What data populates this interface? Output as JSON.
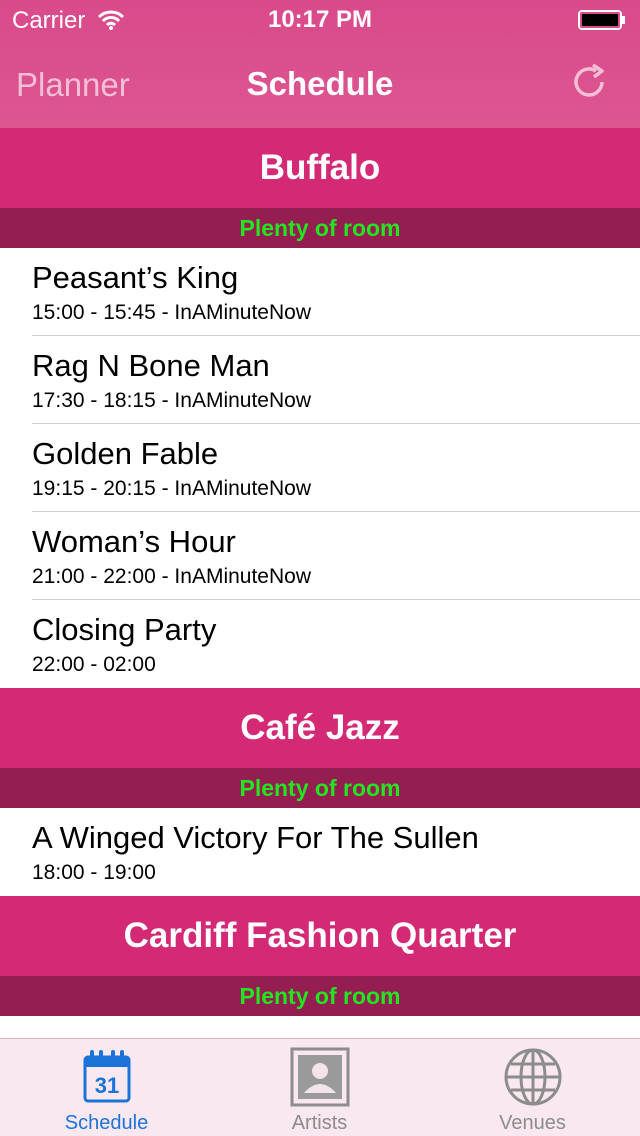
{
  "status_bar": {
    "carrier": "Carrier",
    "time": "10:17 PM"
  },
  "nav": {
    "back_label": "Planner",
    "title": "Schedule",
    "refresh_icon": "refresh-icon"
  },
  "colors": {
    "nav_bg": "#d94a8b",
    "venue_header_bg": "#d42a76",
    "capacity_bg": "#941e52",
    "capacity_text": "#22e61f",
    "tab_active": "#1a73d9"
  },
  "venues": [
    {
      "name": "Buffalo",
      "capacity": "Plenty of room",
      "events": [
        {
          "title": "Peasant’s King",
          "detail": "15:00 - 15:45 - InAMinuteNow"
        },
        {
          "title": "Rag N Bone Man",
          "detail": "17:30 - 18:15 - InAMinuteNow"
        },
        {
          "title": "Golden Fable",
          "detail": "19:15 - 20:15 - InAMinuteNow"
        },
        {
          "title": "Woman’s Hour",
          "detail": "21:00 - 22:00 - InAMinuteNow"
        },
        {
          "title": "Closing Party",
          "detail": "22:00 - 02:00"
        }
      ]
    },
    {
      "name": "Café Jazz",
      "capacity": "Plenty of room",
      "events": [
        {
          "title": "A Winged Victory For The Sullen",
          "detail": "18:00 - 19:00"
        }
      ]
    },
    {
      "name": "Cardiff Fashion Quarter",
      "capacity": "Plenty of room",
      "events": []
    }
  ],
  "tabs": [
    {
      "label": "Schedule",
      "icon": "calendar-icon",
      "badge": "31",
      "active": true
    },
    {
      "label": "Artists",
      "icon": "contact-icon",
      "active": false
    },
    {
      "label": "Venues",
      "icon": "globe-icon",
      "active": false
    }
  ]
}
